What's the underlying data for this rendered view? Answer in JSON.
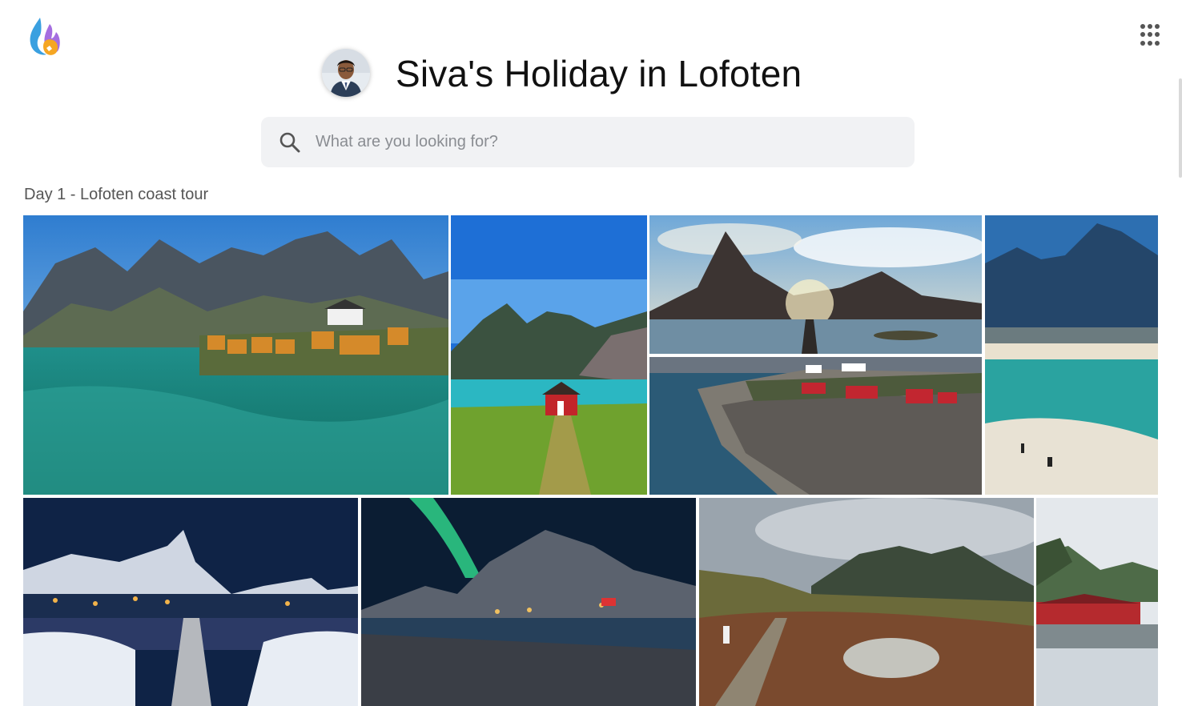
{
  "header": {
    "logo_icon": "flame-cat-logo-icon",
    "apps_icon": "grid-dots-icon",
    "album_title": "Siva's Holiday in Lofoten",
    "avatar_icon": "user-avatar"
  },
  "search": {
    "placeholder": "What are you looking for?",
    "value": ""
  },
  "sections": [
    {
      "title": "Day 1 - Lofoten coast tour",
      "photos": [
        "fishing-village-turquoise-water",
        "red-cabin-green-meadow",
        "sunlit-peak-bridge",
        "red-cabins-rocky-coast",
        "turquoise-beach-mountains",
        "snowy-village-night",
        "northern-lights-mountain",
        "boardwalk-mountain-trail",
        "red-house-harbor"
      ]
    }
  ],
  "colors": {
    "search_bg": "#f1f2f4",
    "section_text": "#555555",
    "title_text": "#111111"
  }
}
